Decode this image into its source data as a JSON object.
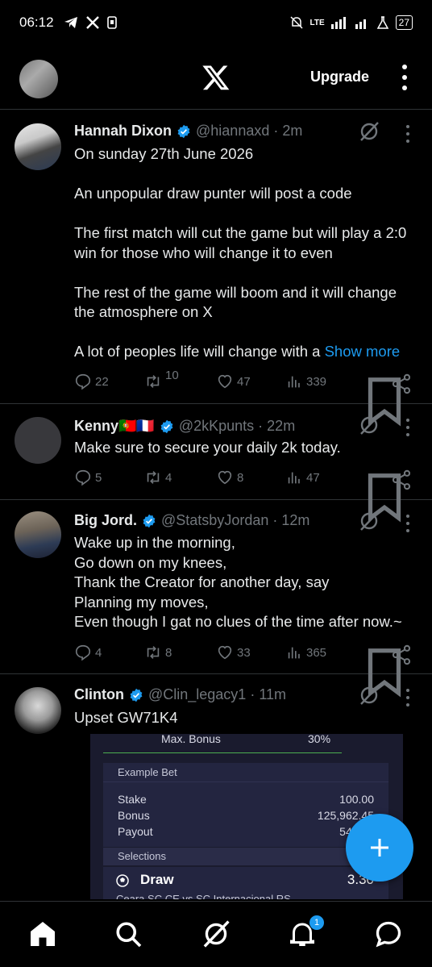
{
  "status_bar": {
    "time": "06:12",
    "battery": "27",
    "net": "LTE"
  },
  "header": {
    "upgrade_label": "Upgrade"
  },
  "tweets": [
    {
      "name": "Hannah Dixon",
      "handle": "@hiannaxd",
      "time": "· 2m",
      "text": "On sunday 27th June 2026\n\nAn unpopular draw punter will post a code\n\nThe first match will cut the game but will play a 2:0 win for those who will change it to even\n\nThe rest of the game will boom and it will change the atmosphere on X\n\nA lot of peoples life will change with a ",
      "show_more": "Show more",
      "replies": "22",
      "reposts": "10",
      "likes": "47",
      "views": "339"
    },
    {
      "name": "Kenny🇵🇹🇫🇷",
      "handle": "@2kKpunts",
      "time": "· 22m",
      "text": "Make sure to secure your daily 2k today.",
      "replies": "5",
      "reposts": "4",
      "likes": "8",
      "views": "47"
    },
    {
      "name": "Big Jord.",
      "handle": "@StatsbyJordan",
      "time": "· 12m",
      "text": "Wake up in the morning,\nGo down on my knees,\nThank the Creator for another day, say\nPlanning my moves,\nEven though I gat no clues of the time after now.~",
      "replies": "4",
      "reposts": "8",
      "likes": "33",
      "views": "365"
    },
    {
      "name": "Clinton",
      "handle": "@Clin_legacy1",
      "time": "· 11m",
      "text": "Upset GW71K4"
    }
  ],
  "media": {
    "max_bonus_label": "Max. Bonus",
    "max_bonus_value": "30%",
    "example_bet": "Example Bet",
    "stake_label": "Stake",
    "stake_value": "100.00",
    "bonus_label": "Bonus",
    "bonus_value": "125,962.45",
    "payout_label": "Payout",
    "payout_value": "545,83",
    "selections": "Selections",
    "pick": "Draw",
    "odds": "3.30",
    "match": "Ceara SC CE vs SC Internacional RS"
  },
  "notifications_badge": "1",
  "colors": {
    "accent": "#1d9bf0",
    "muted": "#71767b",
    "divider": "#2f3336"
  }
}
